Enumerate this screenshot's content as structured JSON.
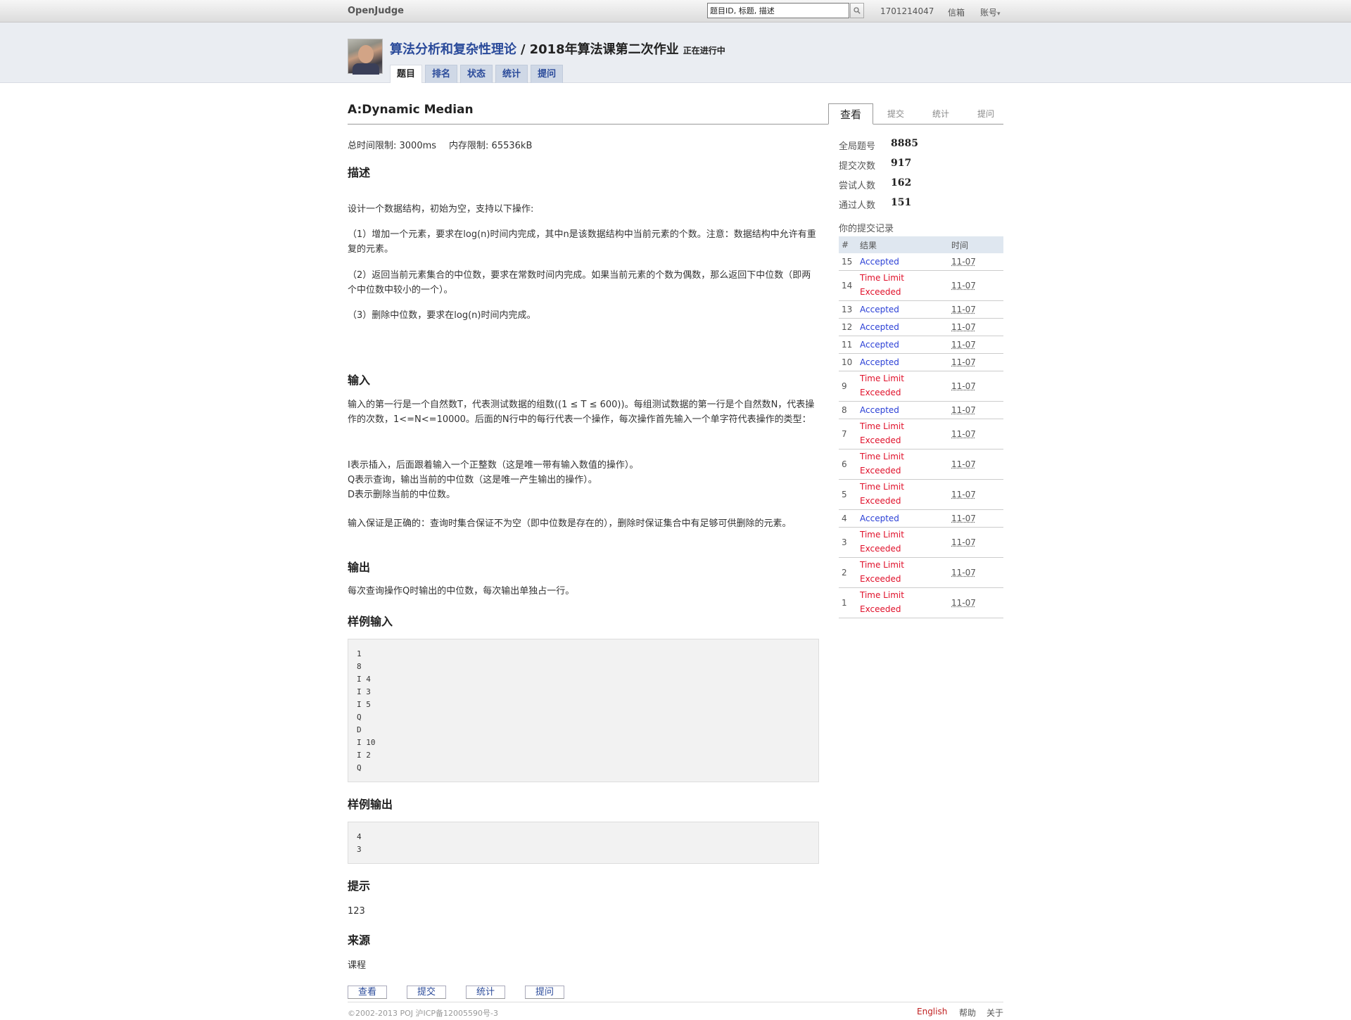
{
  "topbar": {
    "logo": "OpenJudge",
    "search_value": "题目ID, 标题, 描述",
    "search_icon": "search-icon",
    "user_id": "1701214047",
    "mail": "信箱",
    "account": "账号",
    "account_arrow": "▾"
  },
  "header": {
    "course": "算法分析和复杂性理论",
    "separator": "/",
    "contest": "2018年算法课第二次作业",
    "status": "正在进行中",
    "tabs": [
      "题目",
      "排名",
      "状态",
      "统计",
      "提问"
    ]
  },
  "problem": {
    "title": "A:Dynamic Median",
    "view_tabs": [
      "查看",
      "提交",
      "统计",
      "提问"
    ],
    "time_limit": "总时间限制: 3000ms",
    "memory_limit": "内存限制: 65536kB",
    "desc_heading": "描述",
    "desc": [
      "设计一个数据结构，初始为空，支持以下操作:",
      "（1）增加一个元素，要求在log(n)时间内完成，其中n是该数据结构中当前元素的个数。注意：数据结构中允许有重复的元素。",
      "（2）返回当前元素集合的中位数，要求在常数时间内完成。如果当前元素的个数为偶数，那么返回下中位数（即两个中位数中较小的一个）。",
      "（3）删除中位数，要求在log(n)时间内完成。"
    ],
    "input_heading": "输入",
    "input": [
      "输入的第一行是一个自然数T，代表测试数据的组数((1 ≤ T ≤ 600))。每组测试数据的第一行是个自然数N，代表操作的次数，1<=N<=10000。后面的N行中的每行代表一个操作，每次操作首先输入一个单字符代表操作的类型：",
      "I表示插入，后面跟着输入一个正整数（这是唯一带有输入数值的操作）。",
      "Q表示查询，输出当前的中位数（这是唯一产生输出的操作）。",
      "D表示删除当前的中位数。",
      "输入保证是正确的：查询时集合保证不为空（即中位数是存在的），删除时保证集合中有足够可供删除的元素。"
    ],
    "output_heading": "输出",
    "output": "每次查询操作Q时输出的中位数，每次输出单独占一行。",
    "sample_input_heading": "样例输入",
    "sample_input": [
      "1",
      "8",
      "I 4",
      "I 3",
      "I 5",
      "Q",
      "D",
      "I 10",
      "I 2",
      "Q"
    ],
    "sample_output_heading": "样例输出",
    "sample_output": [
      "4",
      "3"
    ],
    "hint_heading": "提示",
    "hint": "123",
    "source_heading": "来源",
    "source": "课程",
    "bottom_tabs": [
      "查看",
      "提交",
      "统计",
      "提问"
    ]
  },
  "sidebar": {
    "stats": [
      {
        "label": "全局题号",
        "value": "8885"
      },
      {
        "label": "提交次数",
        "value": "917"
      },
      {
        "label": "尝试人数",
        "value": "162"
      },
      {
        "label": "通过人数",
        "value": "151"
      }
    ],
    "record_title": "你的提交记录",
    "record_headers": [
      "#",
      "结果",
      "时间"
    ],
    "records": [
      {
        "num": "15",
        "result": "Accepted",
        "time": "11-07"
      },
      {
        "num": "14",
        "result": "Time Limit Exceeded",
        "time": "11-07"
      },
      {
        "num": "13",
        "result": "Accepted",
        "time": "11-07"
      },
      {
        "num": "12",
        "result": "Accepted",
        "time": "11-07"
      },
      {
        "num": "11",
        "result": "Accepted",
        "time": "11-07"
      },
      {
        "num": "10",
        "result": "Accepted",
        "time": "11-07"
      },
      {
        "num": "9",
        "result": "Time Limit Exceeded",
        "time": "11-07"
      },
      {
        "num": "8",
        "result": "Accepted",
        "time": "11-07"
      },
      {
        "num": "7",
        "result": "Time Limit Exceeded",
        "time": "11-07"
      },
      {
        "num": "6",
        "result": "Time Limit Exceeded",
        "time": "11-07"
      },
      {
        "num": "5",
        "result": "Time Limit Exceeded",
        "time": "11-07"
      },
      {
        "num": "4",
        "result": "Accepted",
        "time": "11-07"
      },
      {
        "num": "3",
        "result": "Time Limit Exceeded",
        "time": "11-07"
      },
      {
        "num": "2",
        "result": "Time Limit Exceeded",
        "time": "11-07"
      },
      {
        "num": "1",
        "result": "Time Limit Exceeded",
        "time": "11-07"
      }
    ],
    "colors": {
      "accepted": "#2a3fd6",
      "tle": "#e0102a"
    }
  },
  "footer": {
    "copyright": "©2002-2013 POJ 沪ICP备12005590号-3",
    "english": "English",
    "help": "帮助",
    "about": "关于"
  }
}
